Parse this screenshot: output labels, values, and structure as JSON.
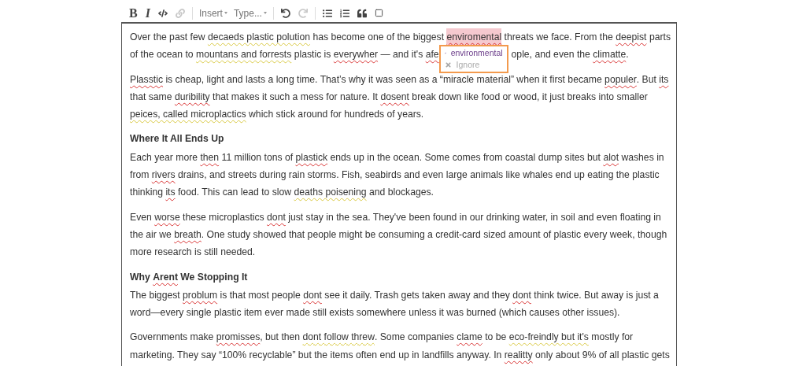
{
  "toolbar": {
    "format": [
      {
        "label": "B",
        "kind": "bold",
        "disabled": false
      },
      {
        "label": "I",
        "kind": "italic",
        "disabled": false
      }
    ],
    "icons": [
      {
        "kind": "code",
        "disabled": false
      },
      {
        "kind": "link",
        "disabled": true
      }
    ],
    "dropdowns": [
      {
        "label": "Insert"
      },
      {
        "label": "Type..."
      }
    ],
    "history": [
      {
        "kind": "undo",
        "disabled": false
      },
      {
        "kind": "redo",
        "disabled": true
      }
    ],
    "blocks": [
      {
        "kind": "bullets",
        "disabled": false
      },
      {
        "kind": "numbers",
        "disabled": false
      },
      {
        "kind": "quote",
        "disabled": false
      },
      {
        "kind": "box",
        "disabled": false
      }
    ]
  },
  "document": [
    {
      "kind": "paragraph",
      "lines": [
        [
          {
            "text": "Over the past few ",
            "kind": "plain"
          },
          {
            "text": "decaeds plastic polution",
            "kind": "grammar"
          },
          {
            "text": " has become one of the biggest ",
            "kind": "plain"
          },
          {
            "text": "enviromental",
            "kind": "active"
          },
          {
            "text": " threats we face. From the ",
            "kind": "plain"
          },
          {
            "text": "deepist",
            "kind": "spelling"
          },
          {
            "text": " parts",
            "kind": "plain"
          }
        ],
        [
          {
            "text": "of the ocean to ",
            "kind": "plain"
          },
          {
            "text": "mountans and forrests",
            "kind": "grammar"
          },
          {
            "text": " plastic is ",
            "kind": "plain"
          },
          {
            "text": "everywher",
            "kind": "spelling"
          },
          {
            "text": " — and it's ",
            "kind": "plain"
          },
          {
            "text": "afe",
            "kind": "spelling"
          },
          {
            "text": "ople, and even the ",
            "kind": "hidden-gap"
          },
          {
            "text": "climatte",
            "kind": "spelling"
          },
          {
            "text": ".",
            "kind": "plain"
          }
        ]
      ]
    },
    {
      "kind": "paragraph",
      "lines": [
        [
          {
            "text": "Plasstic",
            "kind": "spelling"
          },
          {
            "text": " is cheap, light and lasts a long time. That’s why it was seen as a “miracle material” when it first became ",
            "kind": "plain"
          },
          {
            "text": "populer",
            "kind": "spelling"
          },
          {
            "text": ". But ",
            "kind": "plain"
          },
          {
            "text": "its",
            "kind": "spelling"
          }
        ],
        [
          {
            "text": "that same ",
            "kind": "plain"
          },
          {
            "text": "duribility",
            "kind": "spelling"
          },
          {
            "text": " that makes it such a mess for nature. It ",
            "kind": "plain"
          },
          {
            "text": "dosent",
            "kind": "spelling"
          },
          {
            "text": " break down like food or wood, it just breaks into smaller",
            "kind": "plain"
          }
        ],
        [
          {
            "text": "peices, called microplactics",
            "kind": "grammar"
          },
          {
            "text": " which stick around for hundreds of years.",
            "kind": "plain"
          }
        ]
      ]
    },
    {
      "kind": "heading",
      "lines": [
        [
          {
            "text": "Where It All Ends Up",
            "kind": "plain"
          }
        ]
      ]
    },
    {
      "kind": "paragraph",
      "lines": [
        [
          {
            "text": "Each year more ",
            "kind": "plain"
          },
          {
            "text": "then",
            "kind": "spelling"
          },
          {
            "text": " 11 million tons of ",
            "kind": "plain"
          },
          {
            "text": "plastick",
            "kind": "spelling"
          },
          {
            "text": " ends up in the ocean. Some comes from coastal dump sites but ",
            "kind": "plain"
          },
          {
            "text": "alot",
            "kind": "spelling"
          },
          {
            "text": " washes in",
            "kind": "plain"
          }
        ],
        [
          {
            "text": "from ",
            "kind": "plain"
          },
          {
            "text": "rivers",
            "kind": "spelling"
          },
          {
            "text": " drains, and streets during rain storms. Fish, seabirds and even large animals like whales end up eating the plastic",
            "kind": "plain"
          }
        ],
        [
          {
            "text": "thinking ",
            "kind": "plain"
          },
          {
            "text": "its",
            "kind": "spelling"
          },
          {
            "text": " food. This can lead to slow ",
            "kind": "plain"
          },
          {
            "text": "deaths poisening",
            "kind": "grammar"
          },
          {
            "text": " and blockages.",
            "kind": "plain"
          }
        ]
      ]
    },
    {
      "kind": "paragraph",
      "lines": [
        [
          {
            "text": "Even ",
            "kind": "plain"
          },
          {
            "text": "worse",
            "kind": "spelling"
          },
          {
            "text": " these microplastics ",
            "kind": "plain"
          },
          {
            "text": "dont",
            "kind": "spelling"
          },
          {
            "text": " just stay in the sea. They've been found in our drinking water, in soil and even floating in",
            "kind": "plain"
          }
        ],
        [
          {
            "text": "the air we ",
            "kind": "plain"
          },
          {
            "text": "breath",
            "kind": "spelling"
          },
          {
            "text": ". One study showed that people might be consuming a credit-card sized amount of plastic every week, though",
            "kind": "plain"
          }
        ],
        [
          {
            "text": "more research is still needed.",
            "kind": "plain"
          }
        ]
      ]
    },
    {
      "kind": "heading",
      "lines": [
        [
          {
            "text": "Why ",
            "kind": "plain"
          },
          {
            "text": "Arent",
            "kind": "spelling"
          },
          {
            "text": " We Stopping It",
            "kind": "plain"
          }
        ]
      ]
    },
    {
      "kind": "paragraph",
      "lines": [
        [
          {
            "text": "The biggest ",
            "kind": "plain"
          },
          {
            "text": "problum",
            "kind": "spelling"
          },
          {
            "text": " is that most people ",
            "kind": "plain"
          },
          {
            "text": "dont",
            "kind": "spelling"
          },
          {
            "text": " see it daily. Trash gets taken away and they ",
            "kind": "plain"
          },
          {
            "text": "dont",
            "kind": "spelling"
          },
          {
            "text": " think twice. But away is just a",
            "kind": "plain"
          }
        ],
        [
          {
            "text": "word—every single plastic item ever made still exists somewhere unless it was burned (which causes other issues).",
            "kind": "plain"
          }
        ]
      ]
    },
    {
      "kind": "paragraph",
      "lines": [
        [
          {
            "text": "Governments make ",
            "kind": "plain"
          },
          {
            "text": "promisses",
            "kind": "spelling"
          },
          {
            "text": ", but then ",
            "kind": "plain"
          },
          {
            "text": "dont follow threw",
            "kind": "grammar"
          },
          {
            "text": ". Some companies ",
            "kind": "plain"
          },
          {
            "text": "clame",
            "kind": "spelling"
          },
          {
            "text": " to be ",
            "kind": "plain"
          },
          {
            "text": "eco-freindly but it's",
            "kind": "grammar"
          },
          {
            "text": " mostly for",
            "kind": "plain"
          }
        ],
        [
          {
            "text": "marketing. They say “100% recyclable” but the items often end up in landfills anyway. In ",
            "kind": "plain"
          },
          {
            "text": "realitty",
            "kind": "spelling"
          },
          {
            "text": " only about 9% of all plastic gets",
            "kind": "plain"
          }
        ]
      ]
    }
  ],
  "suggestions": [
    {
      "kind": "accept",
      "label": "environmental"
    },
    {
      "kind": "ignore",
      "label": "Ignore"
    }
  ]
}
